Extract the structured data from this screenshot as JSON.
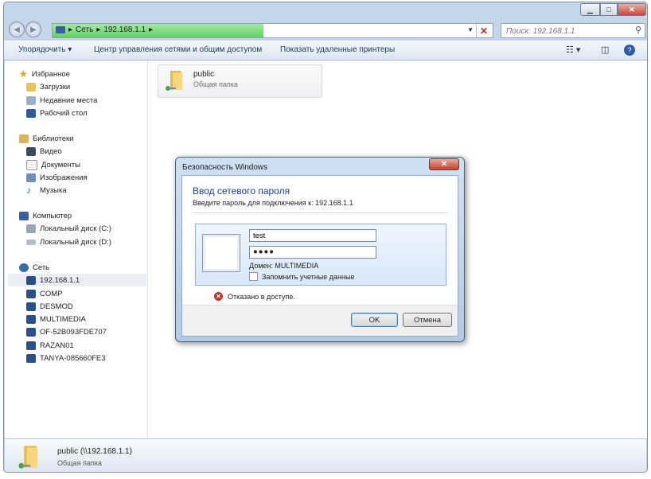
{
  "window": {
    "min_label": "▁",
    "max_label": "□",
    "close_label": "✕"
  },
  "address": {
    "crumb_root": "Сеть",
    "crumb_host": "192.168.1.1",
    "search_placeholder": "Поиск: 192.168.1.1"
  },
  "toolbar": {
    "organize": "Упорядочить ▾",
    "network_center": "Центр управления сетями и общим доступом",
    "show_printers": "Показать удаленные принтеры"
  },
  "sidebar": {
    "favorites": {
      "label": "Избранное",
      "items": [
        "Загрузки",
        "Недавние места",
        "Рабочий стол"
      ]
    },
    "libraries": {
      "label": "Библиотеки",
      "items": [
        "Видео",
        "Документы",
        "Изображения",
        "Музыка"
      ]
    },
    "computer": {
      "label": "Компьютер",
      "items": [
        "Локальный диск (C:)",
        "Локальный диск (D:)"
      ]
    },
    "network": {
      "label": "Сеть",
      "items": [
        "192.168.1.1",
        "COMP",
        "DESMOD",
        "MULTIMEDIA",
        "OF-52B093FDE707",
        "RAZAN01",
        "TANYA-085660FE3"
      ]
    }
  },
  "share": {
    "name": "public",
    "type": "Общая папка"
  },
  "status": {
    "name": "public (\\\\192.168.1.1)",
    "type": "Общая папка"
  },
  "dialog": {
    "title": "Безопасность Windows",
    "heading": "Ввод сетевого пароля",
    "subtitle": "Введите пароль для подключения к: 192.168.1.1",
    "username": "test",
    "password_mask": "●●●●",
    "domain": "Домен: MULTIMEDIA",
    "remember": "Запомнить учетные данные",
    "error": "Отказано в доступе.",
    "ok": "OK",
    "cancel": "Отмена"
  }
}
